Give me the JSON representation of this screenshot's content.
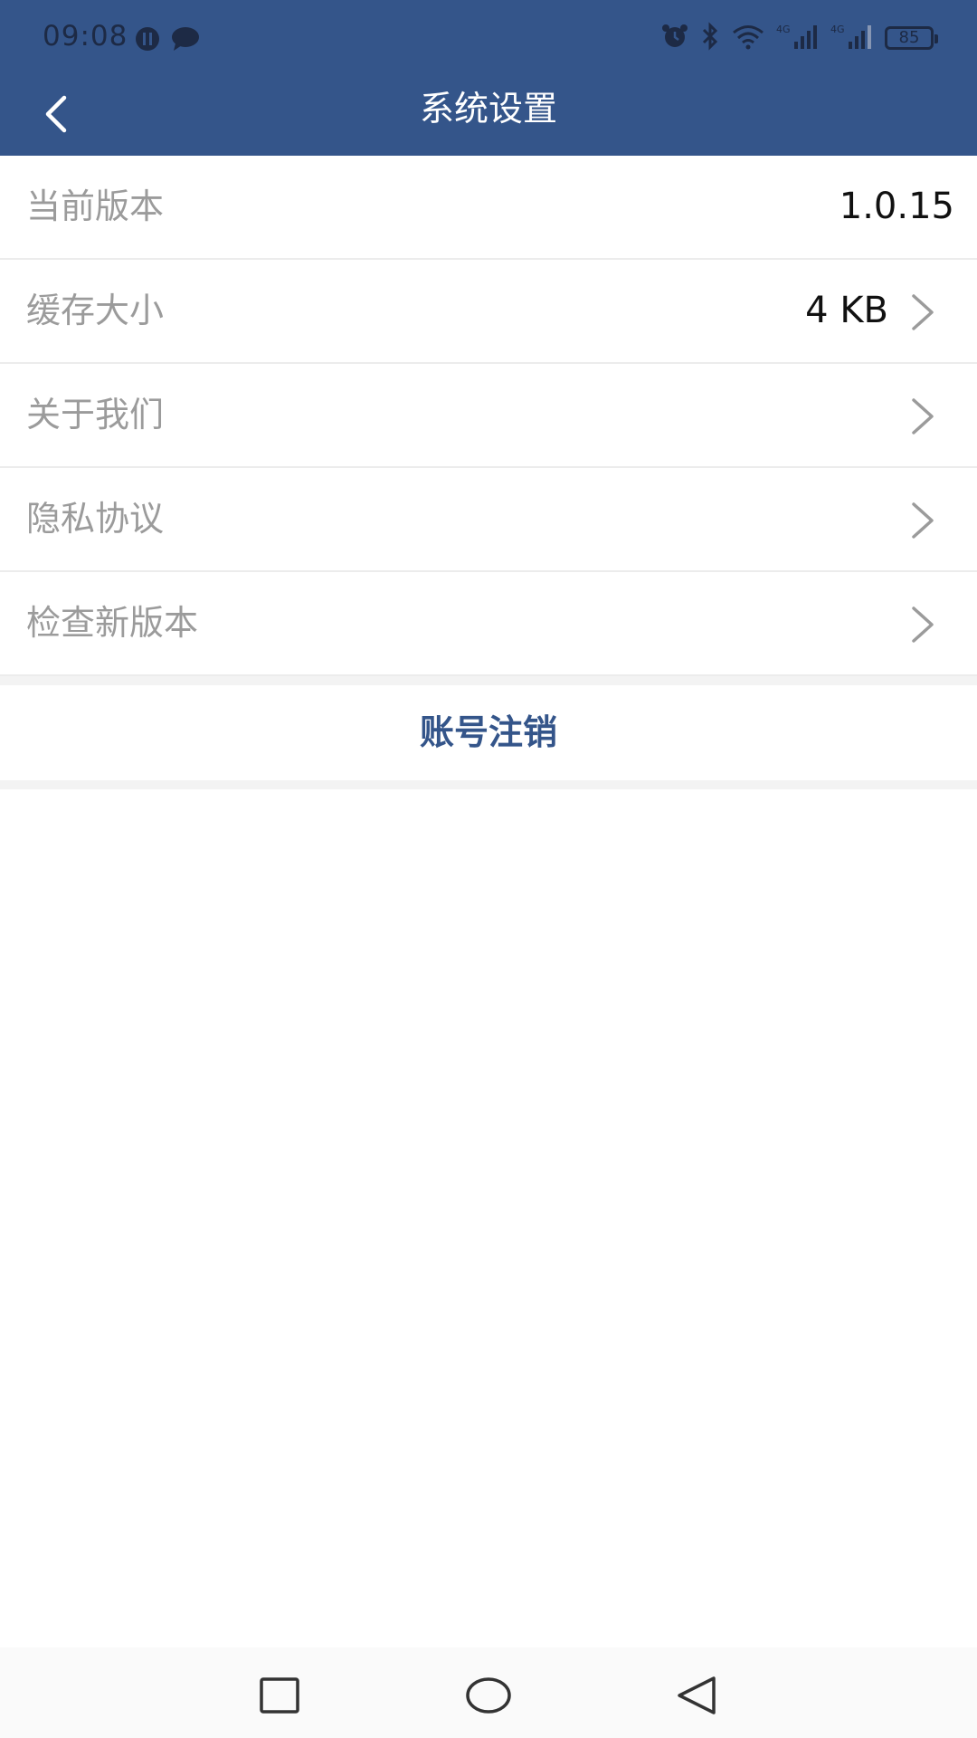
{
  "status_bar": {
    "time": "09:08",
    "battery": "85",
    "network_1": "4G",
    "network_2": "4G"
  },
  "header": {
    "title": "系统设置",
    "background": "#34558a"
  },
  "settings": {
    "items": [
      {
        "label": "当前版本",
        "value": "1.0.15",
        "chevron": false
      },
      {
        "label": "缓存大小",
        "value": "4 KB",
        "chevron": true
      },
      {
        "label": "关于我们",
        "value": "",
        "chevron": true
      },
      {
        "label": "隐私协议",
        "value": "",
        "chevron": true
      },
      {
        "label": "检查新版本",
        "value": "",
        "chevron": true
      }
    ]
  },
  "account": {
    "logout_label": "账号注销",
    "accent": "#34558a"
  },
  "icons": {
    "back": "chevron-left-icon",
    "row_arrow": "chevron-right-icon",
    "nav_recents": "square-icon",
    "nav_home": "circle-icon",
    "nav_back": "triangle-back-icon"
  }
}
